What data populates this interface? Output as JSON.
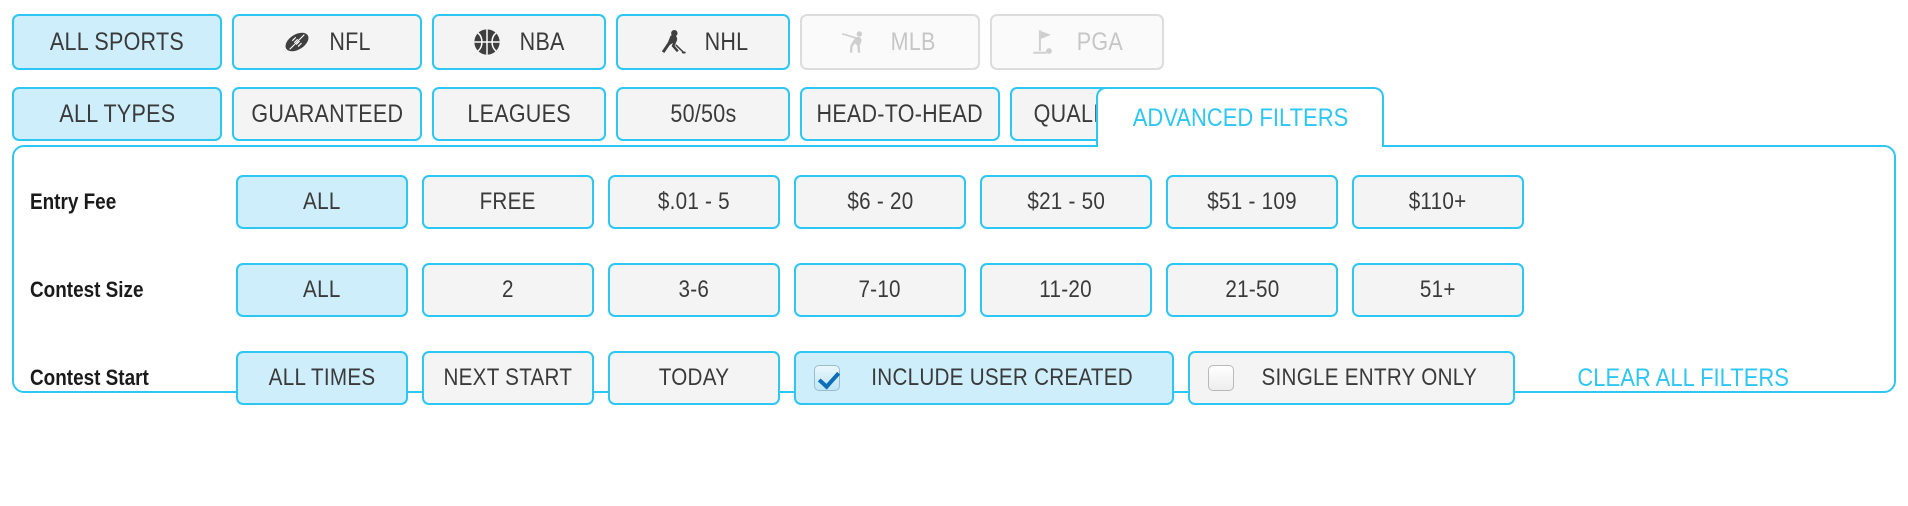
{
  "theme": {
    "accent": "#2EC6F2",
    "active_fill": "#CDEEFA",
    "inactive_fill": "#F4F4F4",
    "disabled_border": "#DCDCDC",
    "disabled_text": "#C6C6C6",
    "text": "#3A3A3A"
  },
  "sports_row": {
    "items": [
      {
        "label": "ALL SPORTS",
        "icon": "none",
        "state": "active"
      },
      {
        "label": "NFL",
        "icon": "football-icon",
        "state": "enabled"
      },
      {
        "label": "NBA",
        "icon": "basketball-icon",
        "state": "enabled"
      },
      {
        "label": "NHL",
        "icon": "hockey-icon",
        "state": "enabled"
      },
      {
        "label": "MLB",
        "icon": "baseball-icon",
        "state": "disabled"
      },
      {
        "label": "PGA",
        "icon": "golf-icon",
        "state": "disabled"
      }
    ]
  },
  "types_row": {
    "items": [
      {
        "label": "ALL TYPES",
        "state": "active"
      },
      {
        "label": "GUARANTEED",
        "state": "enabled"
      },
      {
        "label": "LEAGUES",
        "state": "enabled"
      },
      {
        "label": "50/50s",
        "state": "enabled"
      },
      {
        "label": "HEAD-TO-HEAD",
        "state": "enabled"
      },
      {
        "label": "QUALIFIERS",
        "state": "enabled"
      }
    ],
    "advanced_filters_tab": "ADVANCED FILTERS"
  },
  "panel": {
    "rows": [
      {
        "label": "Entry Fee",
        "options": [
          {
            "label": "ALL",
            "state": "active"
          },
          {
            "label": "FREE",
            "state": "enabled"
          },
          {
            "label": "$.01 - 5",
            "state": "enabled"
          },
          {
            "label": "$6 - 20",
            "state": "enabled"
          },
          {
            "label": "$21 - 50",
            "state": "enabled"
          },
          {
            "label": "$51 - 109",
            "state": "enabled"
          },
          {
            "label": "$110+",
            "state": "enabled"
          }
        ]
      },
      {
        "label": "Contest Size",
        "options": [
          {
            "label": "ALL",
            "state": "active"
          },
          {
            "label": "2",
            "state": "enabled"
          },
          {
            "label": "3-6",
            "state": "enabled"
          },
          {
            "label": "7-10",
            "state": "enabled"
          },
          {
            "label": "11-20",
            "state": "enabled"
          },
          {
            "label": "21-50",
            "state": "enabled"
          },
          {
            "label": "51+",
            "state": "enabled"
          }
        ]
      },
      {
        "label": "Contest Start",
        "options": [
          {
            "label": "ALL TIMES",
            "state": "active"
          },
          {
            "label": "NEXT START",
            "state": "enabled"
          },
          {
            "label": "TODAY",
            "state": "enabled"
          }
        ],
        "checkboxes": [
          {
            "label": "INCLUDE USER CREATED",
            "checked": true
          },
          {
            "label": "SINGLE ENTRY ONLY",
            "checked": false
          }
        ],
        "clear_link": "CLEAR ALL FILTERS"
      }
    ]
  }
}
